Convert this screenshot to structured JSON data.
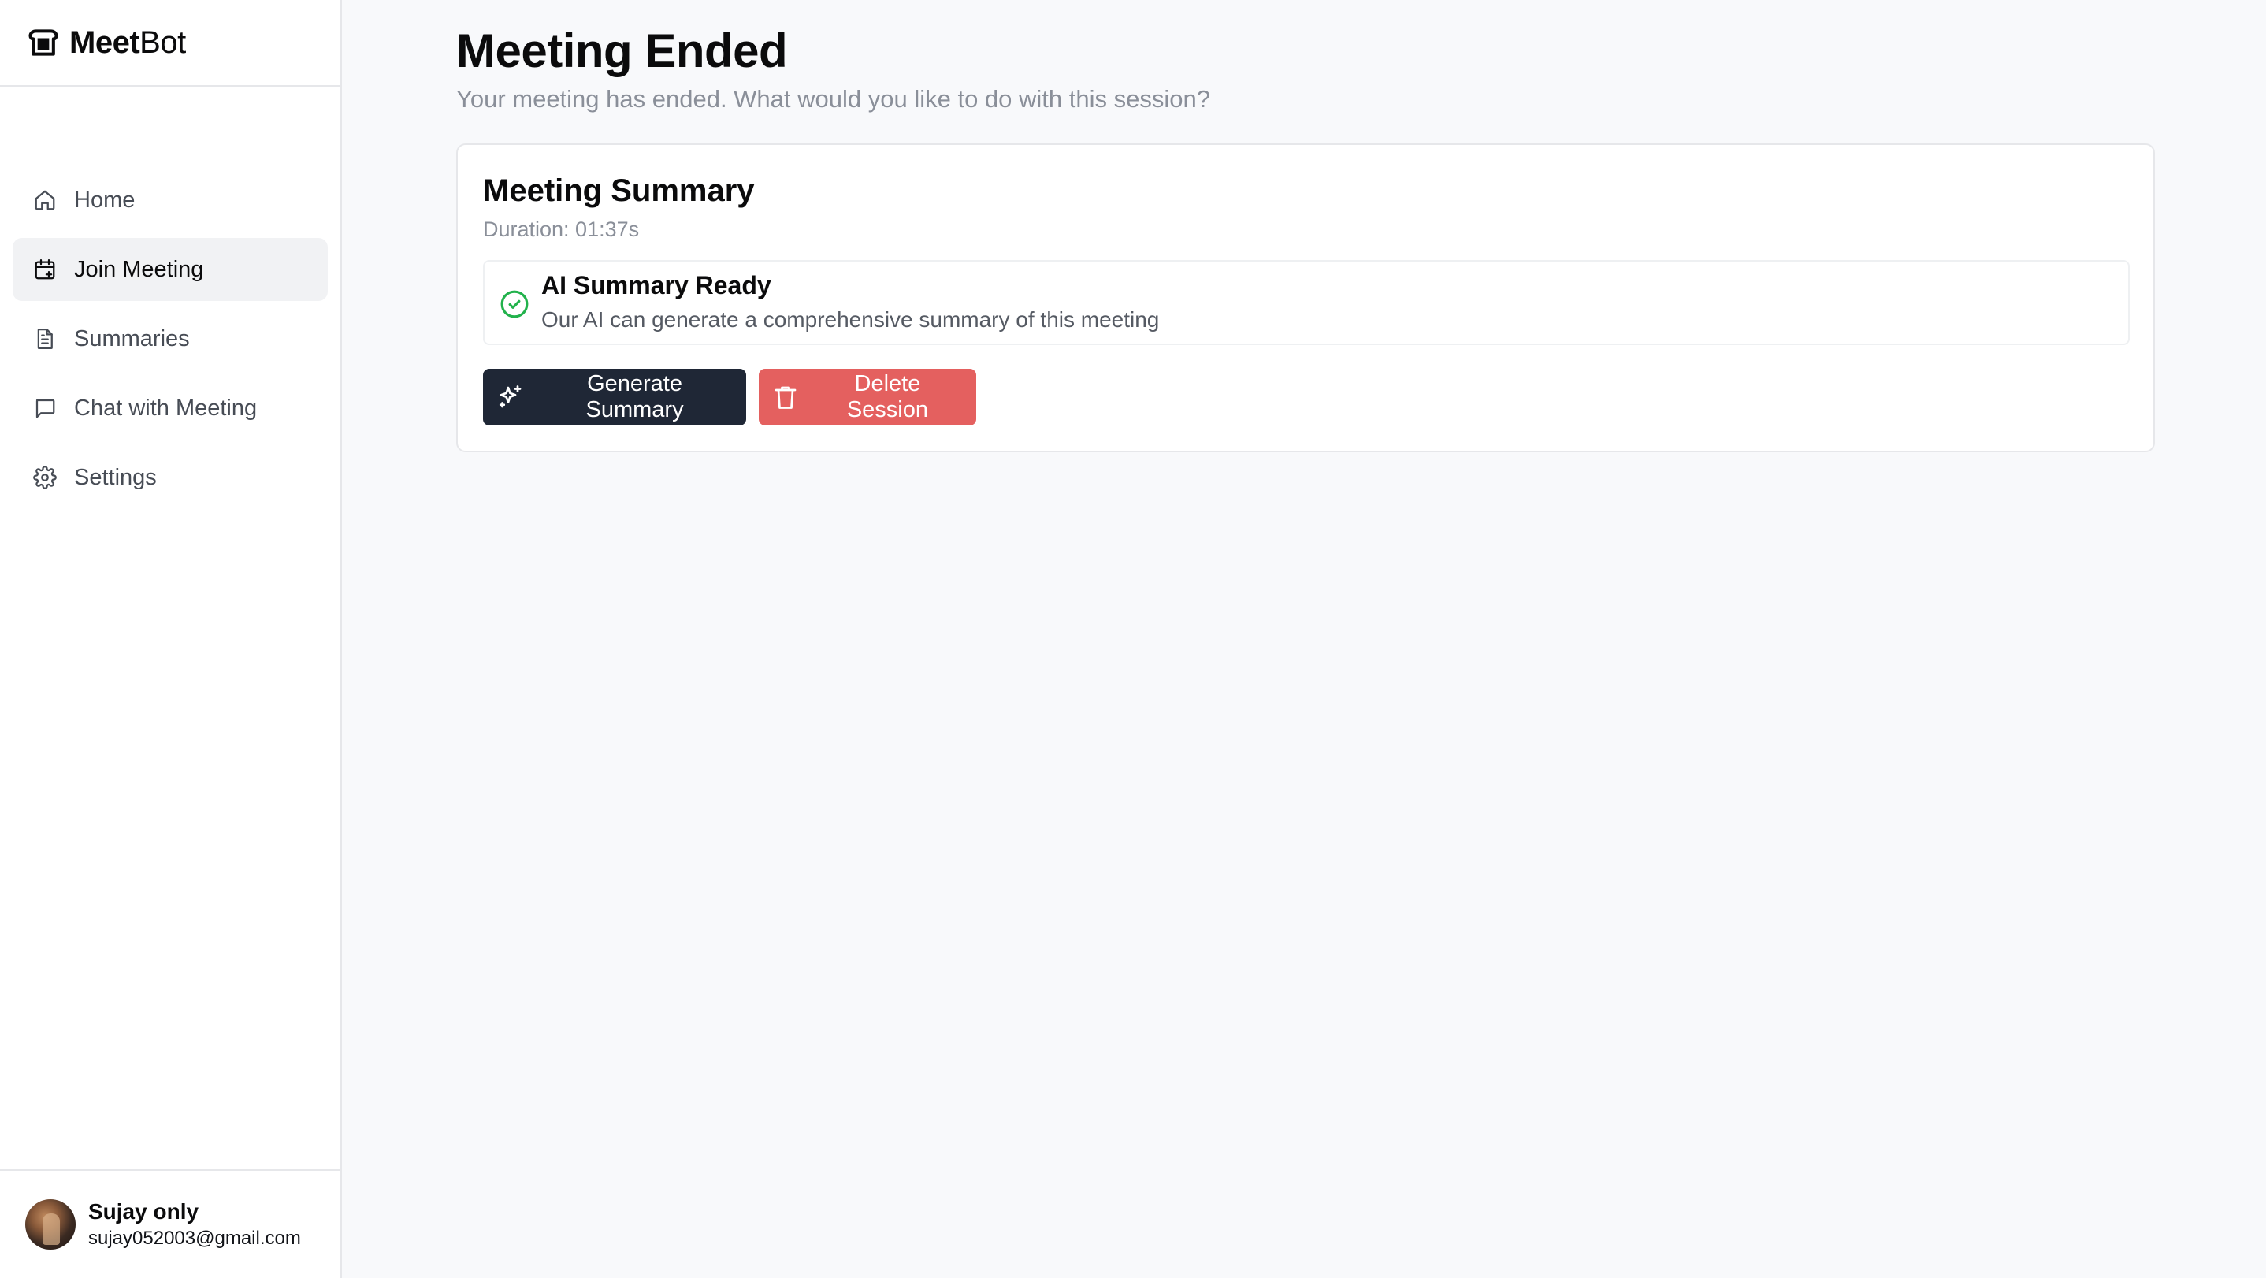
{
  "brand": {
    "name_bold": "Meet",
    "name_regular": "Bot",
    "icon": "bread-icon"
  },
  "sidebar": {
    "items": [
      {
        "label": "Home",
        "icon": "home-icon",
        "active": false
      },
      {
        "label": "Join Meeting",
        "icon": "calendar-plus-icon",
        "active": true
      },
      {
        "label": "Summaries",
        "icon": "document-icon",
        "active": false
      },
      {
        "label": "Chat with Meeting",
        "icon": "chat-bubble-icon",
        "active": false
      },
      {
        "label": "Settings",
        "icon": "gear-icon",
        "active": false
      }
    ]
  },
  "user": {
    "name": "Sujay only",
    "email": "sujay052003@gmail.com"
  },
  "main": {
    "title": "Meeting Ended",
    "subtitle": "Your meeting has ended. What would you like to do with this session?",
    "card": {
      "title": "Meeting Summary",
      "duration": "Duration: 01:37s",
      "status": {
        "title": "AI Summary Ready",
        "description": "Our AI can generate a comprehensive summary of this meeting",
        "icon": "check-circle-icon"
      },
      "buttons": {
        "generate": "Generate Summary",
        "delete": "Delete Session"
      }
    }
  },
  "colors": {
    "primary_button": "#1f2736",
    "danger_button": "#e4605f",
    "success": "#22b24c",
    "active_nav_bg": "#f1f2f4"
  }
}
